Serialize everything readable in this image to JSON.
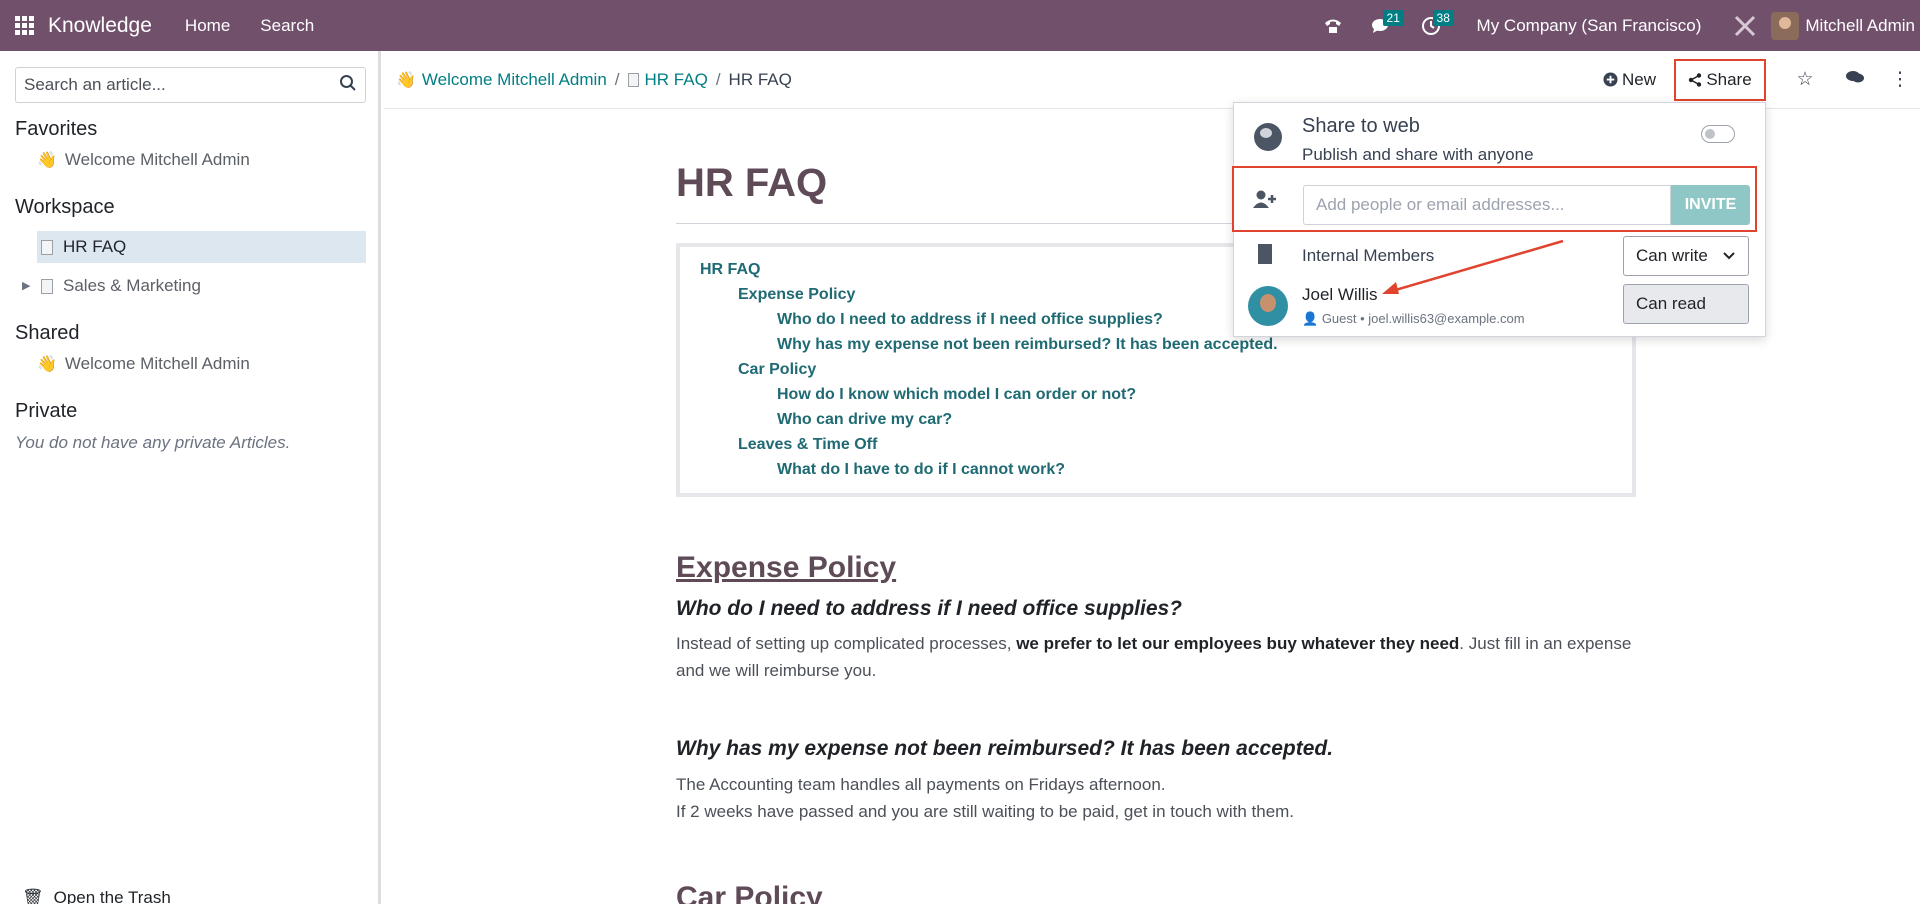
{
  "navbar": {
    "app_name": "Knowledge",
    "links": [
      "Home",
      "Search"
    ],
    "messages_count": "21",
    "activities_count": "38",
    "company": "My Company (San Francisco)",
    "user": "Mitchell Admin"
  },
  "sidebar": {
    "search_placeholder": "Search an article...",
    "favorites": {
      "heading": "Favorites",
      "items": [
        "Welcome Mitchell Admin"
      ]
    },
    "workspace": {
      "heading": "Workspace",
      "items": [
        "HR FAQ",
        "Sales & Marketing"
      ]
    },
    "shared": {
      "heading": "Shared",
      "items": [
        "Welcome Mitchell Admin"
      ]
    },
    "private": {
      "heading": "Private",
      "note": "You do not have any private Articles."
    },
    "trash_label": "Open the Trash"
  },
  "breadcrumb": {
    "items": [
      "Welcome Mitchell Admin",
      "HR FAQ"
    ],
    "current": "HR FAQ"
  },
  "toolbar": {
    "new_label": "New",
    "share_label": "Share"
  },
  "article": {
    "title": "HR FAQ",
    "toc": [
      {
        "text": "HR FAQ",
        "level": 0
      },
      {
        "text": "Expense Policy",
        "level": 1
      },
      {
        "text": "Who do I need to address if I need office supplies?",
        "level": 2
      },
      {
        "text": "Why has my expense not been reimbursed? It has been accepted.",
        "level": 2
      },
      {
        "text": "Car Policy",
        "level": 1
      },
      {
        "text": "How do I know which model I can order or not?",
        "level": 2
      },
      {
        "text": "Who can drive my car?",
        "level": 2
      },
      {
        "text": "Leaves & Time Off",
        "level": 1
      },
      {
        "text": "What do I have to do if I cannot work?",
        "level": 2
      }
    ],
    "section1_heading": "Expense Policy",
    "q1": "Who do I need to address if I need office supplies?",
    "a1_pre": "Instead of setting up complicated processes, ",
    "a1_bold": "we prefer to let our employees buy whatever they need",
    "a1_post": ". Just fill in an expense and we will reimburse you.",
    "q2": "Why has my expense not been reimbursed? It has been accepted.",
    "a2_line1": "The Accounting team handles all payments on Fridays afternoon.",
    "a2_line2": "If 2 weeks have passed and you are still waiting to be paid, get in touch with them.",
    "section2_heading": "Car Policy"
  },
  "share_popover": {
    "web_title": "Share to web",
    "web_subtitle": "Publish and share with anyone",
    "invite_placeholder": "Add people or email addresses...",
    "invite_button": "INVITE",
    "internal_members_label": "Internal Members",
    "internal_permission": "Can write",
    "member_name": "Joel Willis",
    "member_role": "Guest",
    "member_email": "joel.willis63@example.com",
    "member_permission": "Can read"
  },
  "colors": {
    "navbar": "#71506b",
    "link": "#017e84",
    "highlight": "#e0442f",
    "invite_button": "#8fc7c6"
  }
}
